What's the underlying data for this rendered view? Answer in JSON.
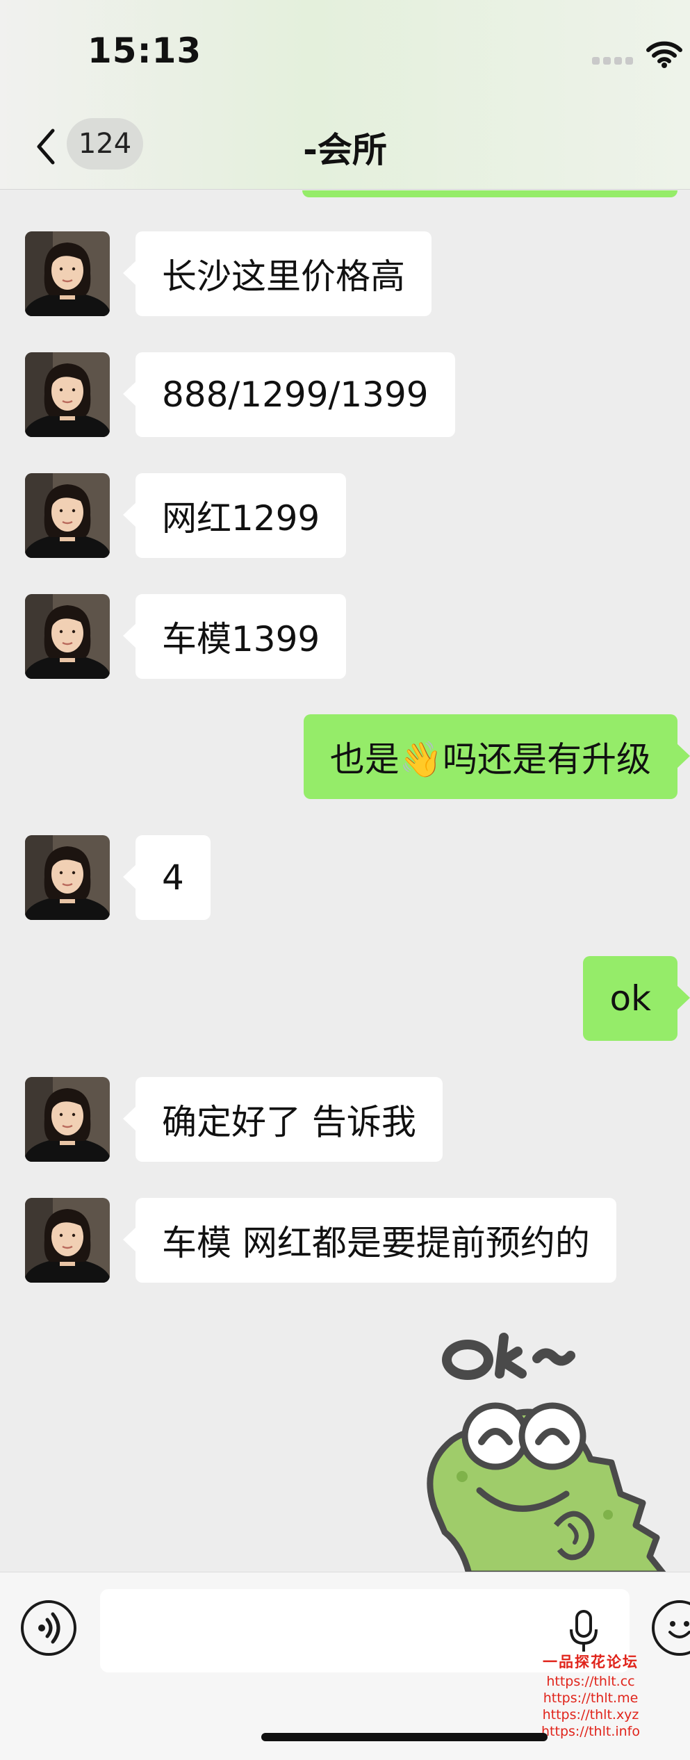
{
  "status_bar": {
    "time": "15:13"
  },
  "nav": {
    "unread_count": "124",
    "title": "-会所"
  },
  "messages": [
    {
      "side": "in",
      "text": "长沙这里价格高"
    },
    {
      "side": "in",
      "text": "888/1299/1399"
    },
    {
      "side": "in",
      "text": "网红1299"
    },
    {
      "side": "in",
      "text": "车模1399"
    },
    {
      "side": "out",
      "text": "也是👋吗还是有升级"
    },
    {
      "side": "in",
      "text": "4"
    },
    {
      "side": "out",
      "text": "ok"
    },
    {
      "side": "in",
      "text": "确定好了  告诉我"
    },
    {
      "side": "in",
      "text": "车模  网红都是要提前预约的"
    }
  ],
  "sticker": {
    "text": "Ok~",
    "description": "frog-sticker"
  },
  "input": {
    "value": ""
  },
  "watermark": {
    "title": "一品探花论坛",
    "urls": [
      "https://thlt.cc",
      "https://thlt.me",
      "https://thlt.xyz",
      "https://thlt.info"
    ]
  },
  "colors": {
    "outgoing_bubble": "#95ec69",
    "incoming_bubble": "#ffffff",
    "background": "#ededed"
  }
}
